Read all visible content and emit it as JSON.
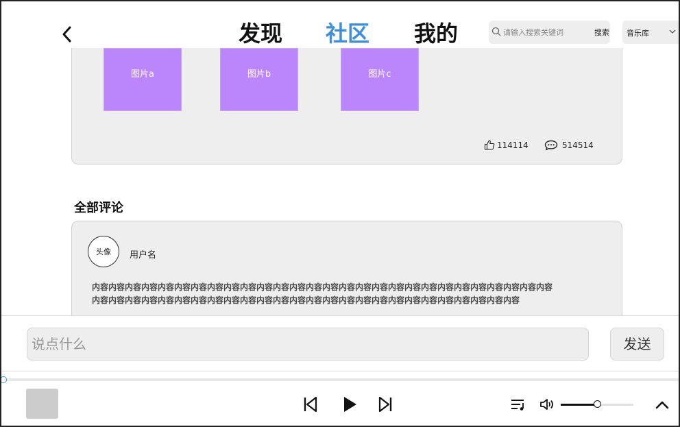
{
  "nav": {
    "back_icon": "chevron-left-icon",
    "tabs": [
      {
        "label": "发现",
        "active": false
      },
      {
        "label": "社区",
        "active": true
      },
      {
        "label": "我的",
        "active": false
      }
    ],
    "search": {
      "placeholder": "请输入搜索关键词",
      "value": "",
      "button_label": "搜索",
      "icon": "search-icon"
    },
    "library_select": {
      "selected": "音乐库",
      "icon": "chevron-down-icon"
    }
  },
  "post": {
    "images": [
      {
        "label": "图片a"
      },
      {
        "label": "图片b"
      },
      {
        "label": "图片c"
      }
    ],
    "likes": "114114",
    "comments": "514514",
    "image_color": "#bb86fc"
  },
  "comments_section": {
    "title": "全部评论",
    "items": [
      {
        "avatar_label": "头像",
        "username": "用户名",
        "content": "内容内容内容内容内容内容内容内容内容内容内容内容内容内容内容内容内容内容内容内容内容内容内容内容内容内容内容内容内容内容内容内容内容内容内容内容内容内容内容内容内容内容内容内容内容内容内容内容内容内容内容内容内容内容"
      }
    ]
  },
  "composer": {
    "placeholder": "说点什么",
    "value": "",
    "send_label": "发送"
  },
  "player": {
    "progress": 0.0,
    "volume": 0.5,
    "accent_color": "#3d8fdc"
  }
}
